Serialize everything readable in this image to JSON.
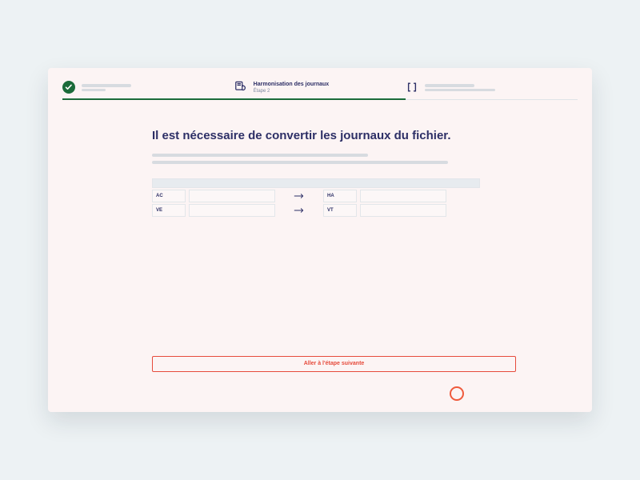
{
  "stepper": {
    "step2": {
      "title": "Harmonisation des journaux",
      "subtitle": "Étape 2"
    }
  },
  "page": {
    "title": "Il est nécessaire de convertir les journaux du fichier."
  },
  "mapping": {
    "rows": [
      {
        "src_code": "AC",
        "src_name": "",
        "tgt_code": "HA",
        "tgt_name": ""
      },
      {
        "src_code": "VE",
        "src_name": "",
        "tgt_code": "VT",
        "tgt_name": ""
      }
    ]
  },
  "cta": {
    "label": "Aller à l'étape suivante"
  }
}
